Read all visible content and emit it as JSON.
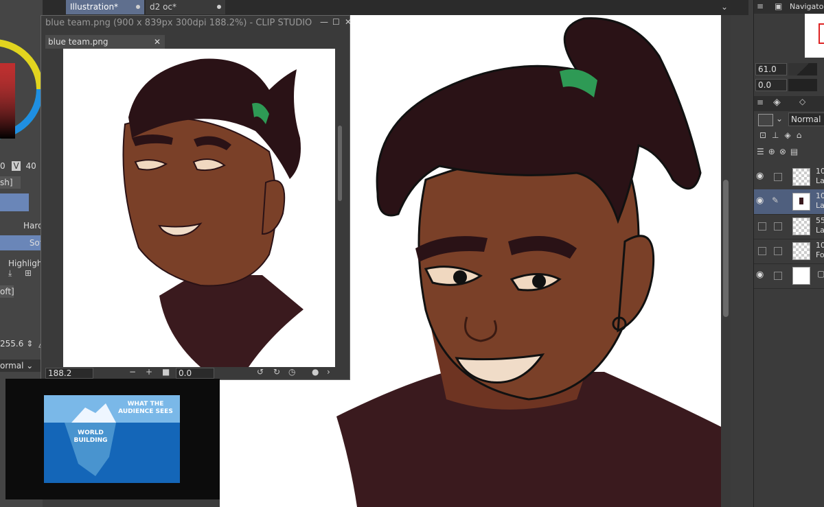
{
  "tabs": [
    {
      "label": "Illustration*",
      "active": true
    },
    {
      "label": "d2 oc*",
      "active": false
    }
  ],
  "navigator": {
    "title": "Navigator"
  },
  "left_panel": {
    "values": {
      "a": "0",
      "v_label": "V",
      "v_value": "40"
    },
    "brush_tab": "sh]",
    "hard_label": "Hard",
    "soft_label": "Sof",
    "highlight_label": "Highligh",
    "soft_tab": "oft]",
    "size_value": "255.6",
    "blend_mode": "ormal"
  },
  "subwindow": {
    "title": "blue team.png (900 x 839px 300dpi 188.2%)  - CLIP STUDIO",
    "tab_label": "blue team.png",
    "zoom_value": "188.2",
    "rotation_value": "0.0"
  },
  "right_panel": {
    "brush_size": "61.0",
    "opacity": "0.0",
    "blend_mode": "Normal",
    "layers": [
      {
        "name_line1": "10",
        "name_line2": "La",
        "visible": true,
        "editing": false,
        "selected": false
      },
      {
        "name_line1": "10",
        "name_line2": "La",
        "visible": true,
        "editing": true,
        "selected": true
      },
      {
        "name_line1": "55",
        "name_line2": "La",
        "visible": false,
        "editing": false,
        "selected": false
      },
      {
        "name_line1": "10",
        "name_line2": "Fo",
        "visible": false,
        "editing": false,
        "selected": false
      },
      {
        "name_line1": "",
        "name_line2": "",
        "visible": true,
        "editing": false,
        "selected": false
      }
    ]
  },
  "video": {
    "caption_top": "WHAT THE AUDIENCE SEES",
    "caption_bottom": "WORLD BUILDING"
  },
  "colors": {
    "skin": "#7a4028",
    "hair": "#2a1216",
    "shirt": "#3a1a1e",
    "hair_tie": "#2e9a55",
    "accent_tab": "#5f6f8e"
  }
}
